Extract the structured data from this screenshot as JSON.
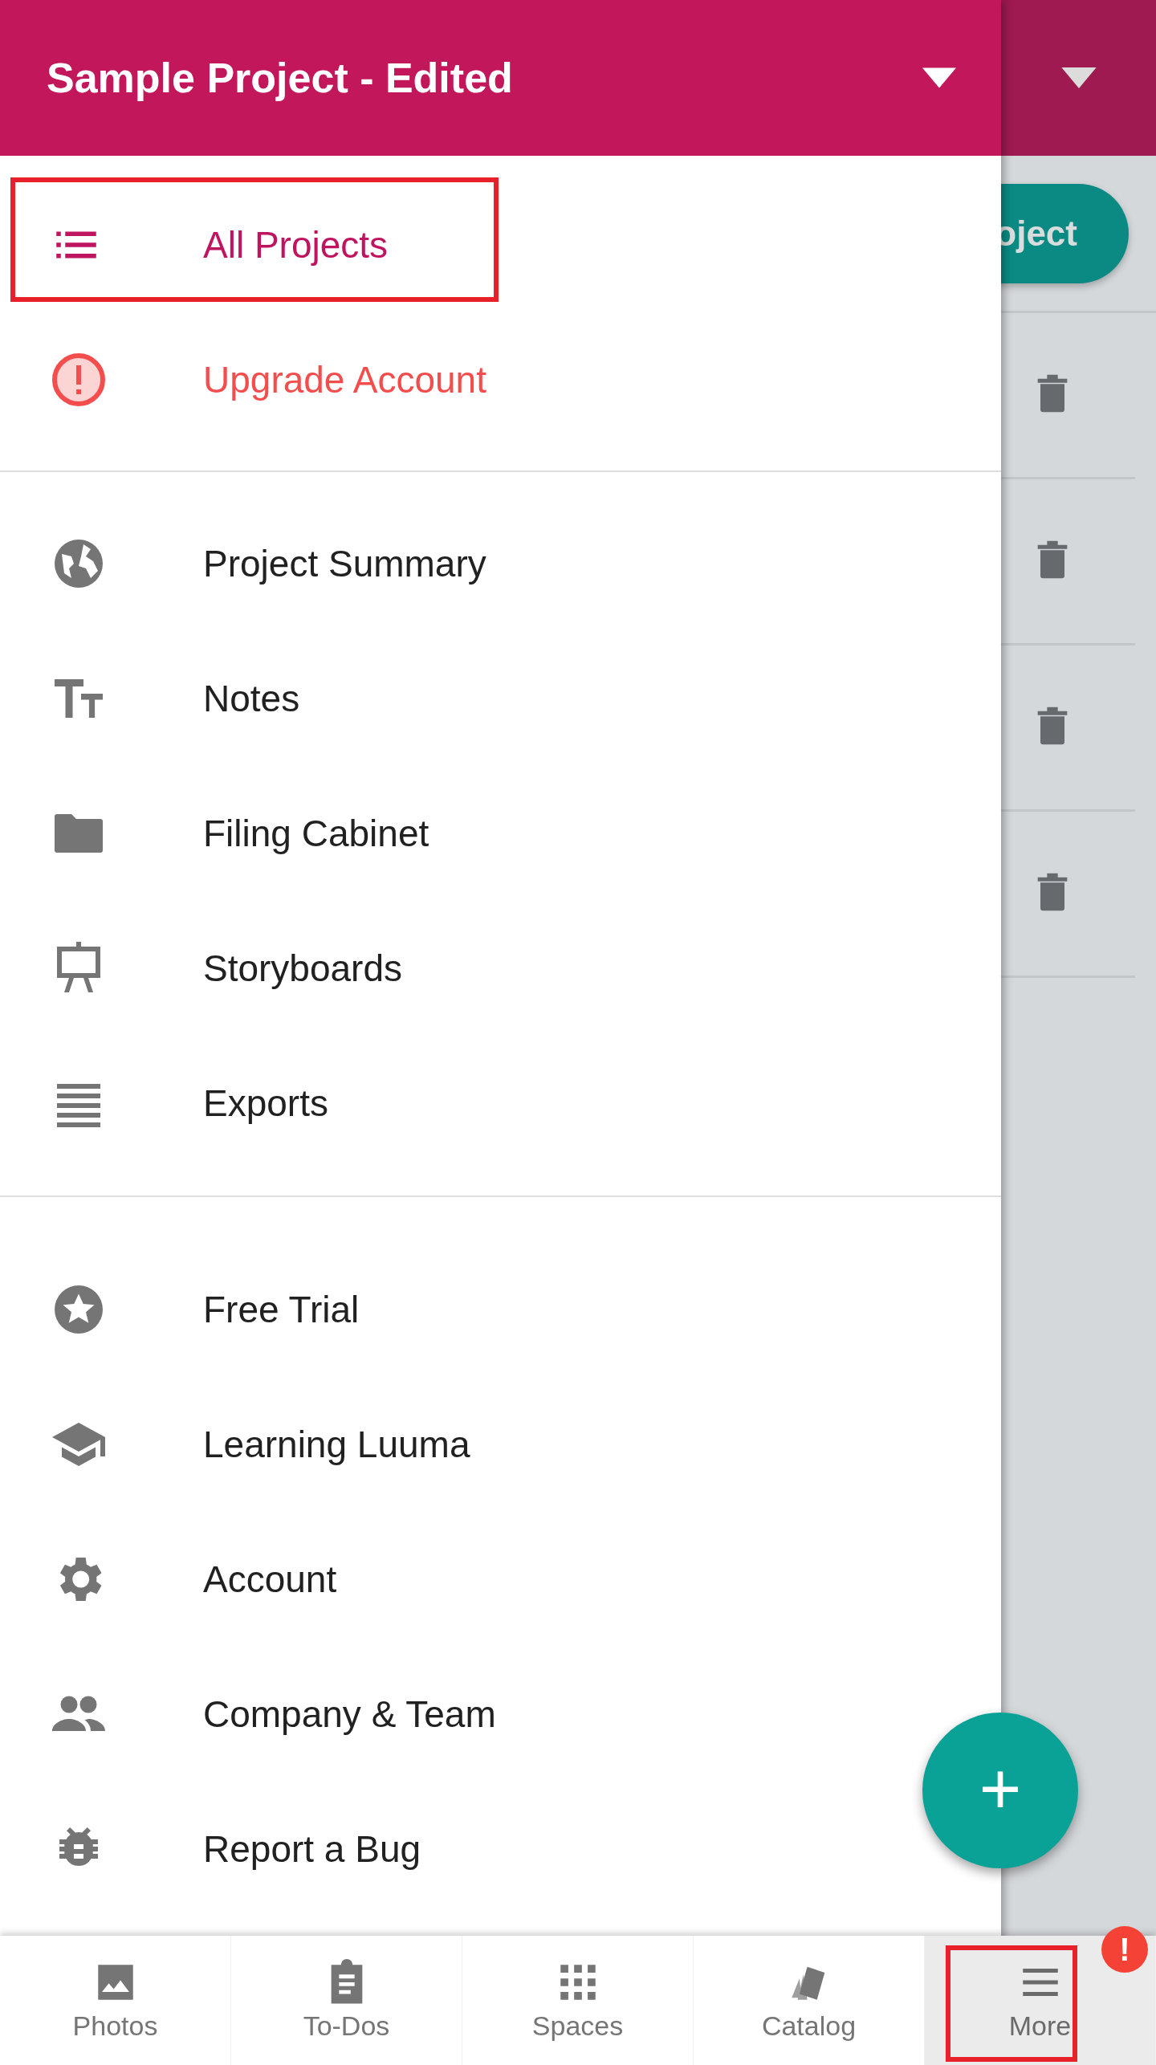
{
  "header": {
    "title": "Sample Project - Edited"
  },
  "background": {
    "button_label": "oject"
  },
  "drawer": {
    "sections": [
      {
        "items": [
          {
            "label": "All Projects",
            "kind": "normal",
            "selected": true,
            "highlighted": true
          },
          {
            "label": "Upgrade Account",
            "kind": "alert",
            "selected": false,
            "highlighted": false
          }
        ]
      },
      {
        "items": [
          {
            "label": "Project Summary",
            "kind": "normal",
            "selected": false,
            "highlighted": false
          },
          {
            "label": "Notes",
            "kind": "normal",
            "selected": false,
            "highlighted": false
          },
          {
            "label": "Filing Cabinet",
            "kind": "normal",
            "selected": false,
            "highlighted": false
          },
          {
            "label": "Storyboards",
            "kind": "normal",
            "selected": false,
            "highlighted": false
          },
          {
            "label": "Exports",
            "kind": "normal",
            "selected": false,
            "highlighted": false
          }
        ]
      },
      {
        "items": [
          {
            "label": "Free Trial",
            "kind": "normal",
            "selected": false,
            "highlighted": false
          },
          {
            "label": "Learning Luuma",
            "kind": "normal",
            "selected": false,
            "highlighted": false
          },
          {
            "label": "Account",
            "kind": "normal",
            "selected": false,
            "highlighted": false
          },
          {
            "label": "Company & Team",
            "kind": "normal",
            "selected": false,
            "highlighted": false
          },
          {
            "label": "Report a Bug",
            "kind": "normal",
            "selected": false,
            "highlighted": false
          }
        ]
      }
    ]
  },
  "fab": {
    "label": "+"
  },
  "tabs": [
    {
      "label": "Photos",
      "selected": false,
      "highlighted": false
    },
    {
      "label": "To-Dos",
      "selected": false,
      "highlighted": false
    },
    {
      "label": "Spaces",
      "selected": false,
      "highlighted": false
    },
    {
      "label": "Catalog",
      "selected": false,
      "highlighted": false
    },
    {
      "label": "More",
      "selected": true,
      "highlighted": true,
      "badge": "!"
    }
  ]
}
